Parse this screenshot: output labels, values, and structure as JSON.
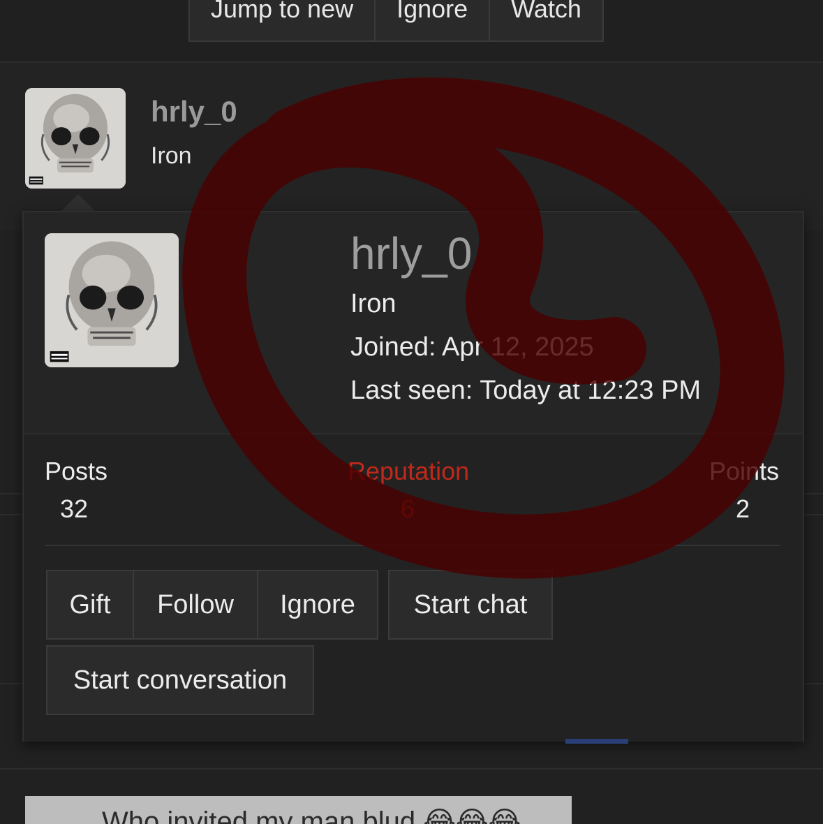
{
  "topbar": {
    "buttons": [
      "Jump to new",
      "Ignore",
      "Watch"
    ]
  },
  "post_author": {
    "username": "hrly_0",
    "title": "Iron"
  },
  "member_card": {
    "username": "hrly_0",
    "title": "Iron",
    "joined": "Joined: Apr 12, 2025",
    "last_seen": "Last seen: Today at 12:23 PM",
    "stats": {
      "posts_label": "Posts",
      "posts_value": "32",
      "reputation_label": "Reputation",
      "reputation_value": "6",
      "points_label": "Points",
      "points_value": "2"
    },
    "actions": {
      "gift": "Gift",
      "follow": "Follow",
      "ignore": "Ignore",
      "start_chat": "Start chat",
      "start_conversation": "Start conversation"
    }
  },
  "thumbnail": {
    "caption": "Who invited my man blud 😂😂😂"
  },
  "colors": {
    "background": "#212121",
    "accent_red": "#c0281a",
    "annotation_stroke": "#4a0000"
  },
  "icons": [
    "skull-avatar-icon"
  ]
}
